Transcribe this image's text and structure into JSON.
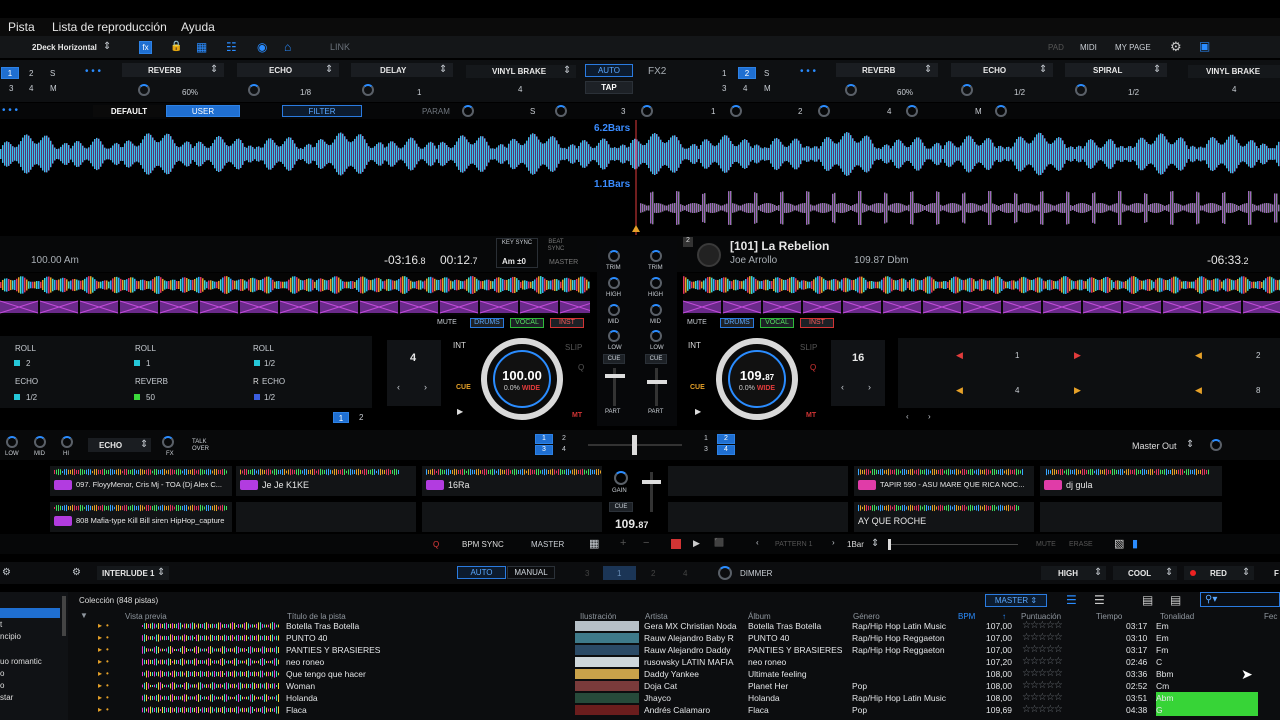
{
  "menu": [
    "Pista",
    "Lista de reproducción",
    "Ayuda"
  ],
  "topbar": {
    "layout": "2Deck Horizontal",
    "link": "LINK",
    "right": [
      "PAD",
      "MIDI",
      "MY PAGE"
    ]
  },
  "fx1": {
    "decks_top": [
      "1",
      "2",
      "S"
    ],
    "decks_bottom": [
      "3",
      "4",
      "M"
    ],
    "slots": [
      "REVERB",
      "ECHO",
      "DELAY"
    ],
    "values": [
      "60%",
      "1/8",
      "1"
    ],
    "vinyl": "VINYL BRAKE",
    "vinyl_val": "4",
    "auto": "AUTO",
    "tap": "TAP",
    "fx2_label": "FX2"
  },
  "fx2": {
    "decks_top": [
      "1",
      "2",
      "S"
    ],
    "decks_bottom": [
      "3",
      "4",
      "M"
    ],
    "slots": [
      "REVERB",
      "ECHO",
      "SPIRAL"
    ],
    "values": [
      "60%",
      "1/2",
      "1/2"
    ],
    "vinyl": "VINYL BRAKE",
    "vinyl_val": "4"
  },
  "tabs": {
    "default": "DEFAULT",
    "user": "USER",
    "filter": "FILTER",
    "param": "PARAM",
    "pads": [
      "S",
      "3",
      "1",
      "2",
      "4",
      "M"
    ]
  },
  "waveform": {
    "bars_top": "6.2Bars",
    "bars_bottom": "1.1Bars"
  },
  "deck1": {
    "key_label": "100.00 Am",
    "remain": "-03:16",
    "remain_frac": ".8",
    "elapsed": "00:12",
    "elapsed_frac": ".7",
    "keysync": "KEY SYNC",
    "key": "Am ±0",
    "beatsync": "BEAT SYNC",
    "master": "MASTER",
    "mute": "MUTE",
    "stems": [
      "DRUMS",
      "VOCAL",
      "INST"
    ],
    "bpm": "100.00",
    "pitch": "0.0%",
    "range": "WIDE",
    "int": "INT",
    "slip": "SLIP",
    "cue": "CUE",
    "mt": "MT",
    "q": "Q",
    "beatloop": "4",
    "pages": [
      "1",
      "2"
    ],
    "pads": [
      {
        "name": "ROLL",
        "val": "2",
        "color": "#25c7d9"
      },
      {
        "name": "ROLL",
        "val": "1",
        "color": "#25c7d9"
      },
      {
        "name": "ROLL",
        "val": "1/2",
        "color": "#25c7d9"
      },
      {
        "name": "ECHO",
        "val": "1/2",
        "color": "#25c7d9"
      },
      {
        "name": "REVERB",
        "val": "50",
        "color": "#3bd93b"
      },
      {
        "name": "ECHO",
        "val": "1/2",
        "color": "#3b5ee0"
      }
    ]
  },
  "deck2": {
    "number": "2",
    "title": "[101] La Rebelion",
    "artist": "Joe Arrollo",
    "key_label": "109.87 Dbm",
    "remain": "-06:33",
    "remain_frac": ".2",
    "mute": "MUTE",
    "stems": [
      "DRUMS",
      "VOCAL",
      "INST"
    ],
    "bpm_int": "109.",
    "bpm_frac": "87",
    "pitch": "0.0%",
    "range": "WIDE",
    "int": "INT",
    "slip": "SLIP",
    "cue": "CUE",
    "mt": "MT",
    "q": "Q",
    "beatloop": "16",
    "pad_nums": [
      "1",
      "2",
      "4",
      "8"
    ]
  },
  "mixer": {
    "labels": [
      "TRIM",
      "HIGH",
      "MID",
      "LOW",
      "CUE",
      "PART"
    ],
    "echo": "ECHO",
    "eq": [
      "LOW",
      "MID",
      "HI"
    ],
    "fx": "FX",
    "talkover": "TALK OVER",
    "master_out": "Master Out",
    "deck_a": [
      "1",
      "2",
      "3",
      "4"
    ],
    "deck_b": [
      "1",
      "2",
      "3",
      "4"
    ]
  },
  "sampler": {
    "left": [
      {
        "name": "097. FloyyMenor, Cris Mj - TOA (Dj Alex C...",
        "color": "#b23ce0"
      },
      {
        "name": "Je Je K1KE",
        "color": "#b23ce0"
      },
      {
        "name": "16Ra",
        "color": "#b23ce0"
      },
      {
        "name": "808 Mafia-type Kill Bill siren HipHop_capture",
        "color": "#b23ce0"
      }
    ],
    "right": [
      {
        "name": "TAPIR 590 - ASU MARE QUE RICA NOC...",
        "color": "#e03ca8"
      },
      {
        "name": "dj gula",
        "color": "#e03ca8"
      },
      {
        "name": "AY QUE ROCHE",
        "color": ""
      }
    ],
    "gain": "GAIN",
    "cue": "CUE",
    "bpm_int": "109.",
    "bpm_frac": "87",
    "q": "Q",
    "bpm_sync": "BPM SYNC",
    "master": "MASTER",
    "pattern": "PATTERN 1",
    "bar": "1Bar",
    "mute": "MUTE",
    "erase": "ERASE"
  },
  "browser_bar": {
    "interlude": "INTERLUDE 1",
    "auto": "AUTO",
    "manual": "MANUAL",
    "nums": [
      "3",
      "1",
      "2",
      "4"
    ],
    "dimmer": "DIMMER",
    "high": "HIGH",
    "cool": "COOL",
    "red": "RED",
    "f": "F"
  },
  "browser": {
    "collection": "Colección (848 pistas)",
    "master": "MASTER",
    "columns": [
      "Vista previa",
      "Título de la pista",
      "Ilustración",
      "Artista",
      "Álbum",
      "Género",
      "BPM",
      "Puntuación",
      "Tiempo",
      "Tonalidad",
      "Fec"
    ],
    "sidebar": [
      "t",
      "ncipio",
      "",
      "uo romantic",
      "o",
      "o",
      "star",
      ""
    ],
    "rows": [
      {
        "title": "Botella Tras Botella",
        "artist": "Gera MX Christian Noda",
        "album": "Botella Tras Botella",
        "genre": "Rap/Hip Hop Latin Music",
        "bpm": "107,00",
        "time": "03:17",
        "key": "Em",
        "key_hl": false
      },
      {
        "title": "PUNTO 40",
        "artist": "Rauw Alejandro Baby R",
        "album": "PUNTO 40",
        "genre": "Rap/Hip Hop Reggaeton",
        "bpm": "107,00",
        "time": "03:10",
        "key": "Em",
        "key_hl": false
      },
      {
        "title": "PANTIES Y BRASIERES",
        "artist": "Rauw Alejandro Daddy",
        "album": "PANTIES Y BRASIERES",
        "genre": "Rap/Hip Hop Reggaeton",
        "bpm": "107,00",
        "time": "03:17",
        "key": "Fm",
        "key_hl": false
      },
      {
        "title": "neo roneo",
        "artist": "rusowsky LATIN MAFIA",
        "album": "neo roneo",
        "genre": "",
        "bpm": "107,20",
        "time": "02:46",
        "key": "C",
        "key_hl": false
      },
      {
        "title": "Que tengo que hacer",
        "artist": "Daddy Yankee",
        "album": "Ultimate feeling",
        "genre": "",
        "bpm": "108,00",
        "time": "03:36",
        "key": "Bbm",
        "key_hl": false
      },
      {
        "title": "Woman",
        "artist": "Doja Cat",
        "album": "Planet Her",
        "genre": "Pop",
        "bpm": "108,00",
        "time": "02:52",
        "key": "Cm",
        "key_hl": false
      },
      {
        "title": "Holanda",
        "artist": "Jhayco",
        "album": "Holanda",
        "genre": "Rap/Hip Hop Latin Music",
        "bpm": "108,00",
        "time": "03:51",
        "key": "Abm",
        "key_hl": true
      },
      {
        "title": "Flaca",
        "artist": "Andrés Calamaro",
        "album": "Flaca",
        "genre": "Pop",
        "bpm": "109,69",
        "time": "04:38",
        "key": "G",
        "key_hl": true
      }
    ]
  },
  "colors": {
    "accent": "#1f6fd1",
    "bg": "#000000",
    "highlight_green": "#37d437"
  }
}
